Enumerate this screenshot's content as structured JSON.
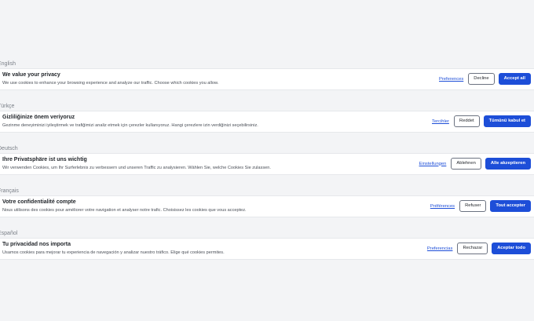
{
  "banners": [
    {
      "language": "English",
      "title": "We value your privacy",
      "text": "We use cookies to enhance your browsing experience and analyze our traffic. Choose which cookies you allow.",
      "preferences": "Preferences",
      "decline": "Decline",
      "accept": "Accept all"
    },
    {
      "language": "Türkçe",
      "title": "Gizliliğinize önem veriyoruz",
      "text": "Gezinme deneyiminizi iyileştirmek ve trafiğimizi analiz etmek için çerezler kullanıyoruz. Hangi çerezlere izin verdiğinizi seçebilirsiniz.",
      "preferences": "Tercihler",
      "decline": "Reddet",
      "accept": "Tümünü kabul et"
    },
    {
      "language": "Deutsch",
      "title": "Ihre Privatsphäre ist uns wichtig",
      "text": "Wir verwenden Cookies, um Ihr Surferlebnis zu verbessern und unseren Traffic zu analysieren. Wählen Sie, welche Cookies Sie zulassen.",
      "preferences": "Einstellungen",
      "decline": "Ablehnen",
      "accept": "Alle akzeptieren"
    },
    {
      "language": "Français",
      "title": "Votre confidentialité compte",
      "text": "Nous utilisons des cookies pour améliorer votre navigation et analyser notre trafic. Choisissez les cookies que vous acceptez.",
      "preferences": "Préférences",
      "decline": "Refuser",
      "accept": "Tout accepter"
    },
    {
      "language": "Español",
      "title": "Tu privacidad nos importa",
      "text": "Usamos cookies para mejorar tu experiencia de navegación y analizar nuestro tráfico. Elige qué cookies permites.",
      "preferences": "Preferencias",
      "decline": "Rechazar",
      "accept": "Aceptar todo"
    }
  ]
}
